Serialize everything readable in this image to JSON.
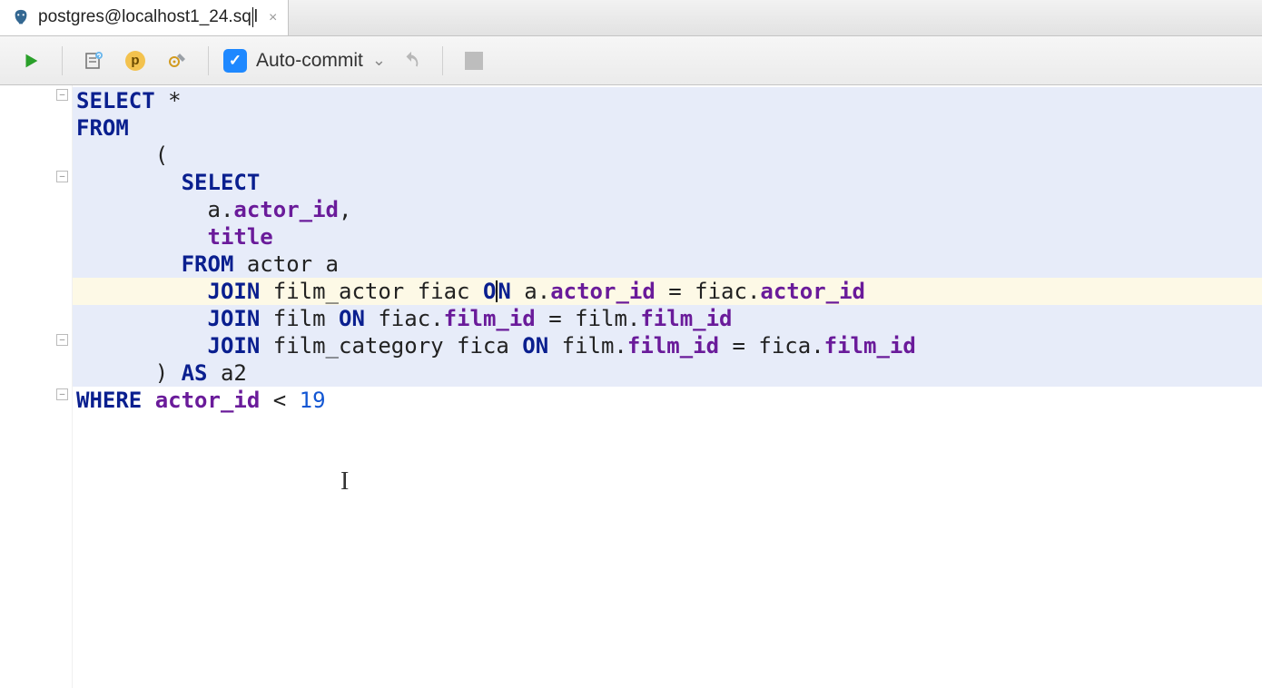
{
  "tab": {
    "title_left": "postgres@localhost1_24.sq",
    "title_after_cursor": "l"
  },
  "toolbar": {
    "auto_commit_label": "Auto-commit"
  },
  "editor": {
    "lines": [
      {
        "type": "sel",
        "tokens": [
          {
            "t": "kw",
            "v": "SELECT"
          },
          {
            "t": "tx",
            "v": " *"
          }
        ]
      },
      {
        "type": "sel",
        "tokens": [
          {
            "t": "kw",
            "v": "FROM"
          }
        ]
      },
      {
        "type": "sel",
        "tokens": [
          {
            "t": "tx",
            "v": "      ("
          }
        ]
      },
      {
        "type": "sel",
        "tokens": [
          {
            "t": "tx",
            "v": "        "
          },
          {
            "t": "kw",
            "v": "SELECT"
          }
        ]
      },
      {
        "type": "sel",
        "tokens": [
          {
            "t": "tx",
            "v": "          a."
          },
          {
            "t": "col",
            "v": "actor_id"
          },
          {
            "t": "tx",
            "v": ","
          }
        ]
      },
      {
        "type": "sel",
        "tokens": [
          {
            "t": "tx",
            "v": "          "
          },
          {
            "t": "col",
            "v": "title"
          }
        ]
      },
      {
        "type": "sel",
        "tokens": [
          {
            "t": "tx",
            "v": "        "
          },
          {
            "t": "kw",
            "v": "FROM"
          },
          {
            "t": "tx",
            "v": " actor a"
          }
        ]
      },
      {
        "type": "hl",
        "tokens": [
          {
            "t": "tx",
            "v": "          "
          },
          {
            "t": "kw",
            "v": "JOIN"
          },
          {
            "t": "tx",
            "v": " film_actor fiac "
          },
          {
            "t": "kw",
            "v": "O"
          },
          {
            "t": "caret",
            "v": ""
          },
          {
            "t": "kw",
            "v": "N"
          },
          {
            "t": "tx",
            "v": " a."
          },
          {
            "t": "col",
            "v": "actor_id"
          },
          {
            "t": "tx",
            "v": " = fiac."
          },
          {
            "t": "col",
            "v": "actor_id"
          }
        ]
      },
      {
        "type": "sel",
        "tokens": [
          {
            "t": "tx",
            "v": "          "
          },
          {
            "t": "kw",
            "v": "JOIN"
          },
          {
            "t": "tx",
            "v": " film "
          },
          {
            "t": "kw",
            "v": "ON"
          },
          {
            "t": "tx",
            "v": " fiac."
          },
          {
            "t": "col",
            "v": "film_id"
          },
          {
            "t": "tx",
            "v": " = film."
          },
          {
            "t": "col",
            "v": "film_id"
          }
        ]
      },
      {
        "type": "sel",
        "tokens": [
          {
            "t": "tx",
            "v": "          "
          },
          {
            "t": "kw",
            "v": "JOIN"
          },
          {
            "t": "tx",
            "v": " film_category fica "
          },
          {
            "t": "kw",
            "v": "ON"
          },
          {
            "t": "tx",
            "v": " film."
          },
          {
            "t": "col",
            "v": "film_id"
          },
          {
            "t": "tx",
            "v": " = fica."
          },
          {
            "t": "col",
            "v": "film_id"
          }
        ]
      },
      {
        "type": "sel",
        "tokens": [
          {
            "t": "tx",
            "v": "      ) "
          },
          {
            "t": "kw",
            "v": "AS"
          },
          {
            "t": "tx",
            "v": " a2"
          }
        ]
      },
      {
        "type": "plain",
        "tokens": [
          {
            "t": "kw",
            "v": "WHERE"
          },
          {
            "t": "tx",
            "v": " "
          },
          {
            "t": "col",
            "v": "actor_id"
          },
          {
            "t": "tx",
            "v": " < "
          },
          {
            "t": "num",
            "v": "19"
          }
        ]
      }
    ],
    "fold_markers_at": [
      0,
      3,
      9,
      11
    ]
  }
}
